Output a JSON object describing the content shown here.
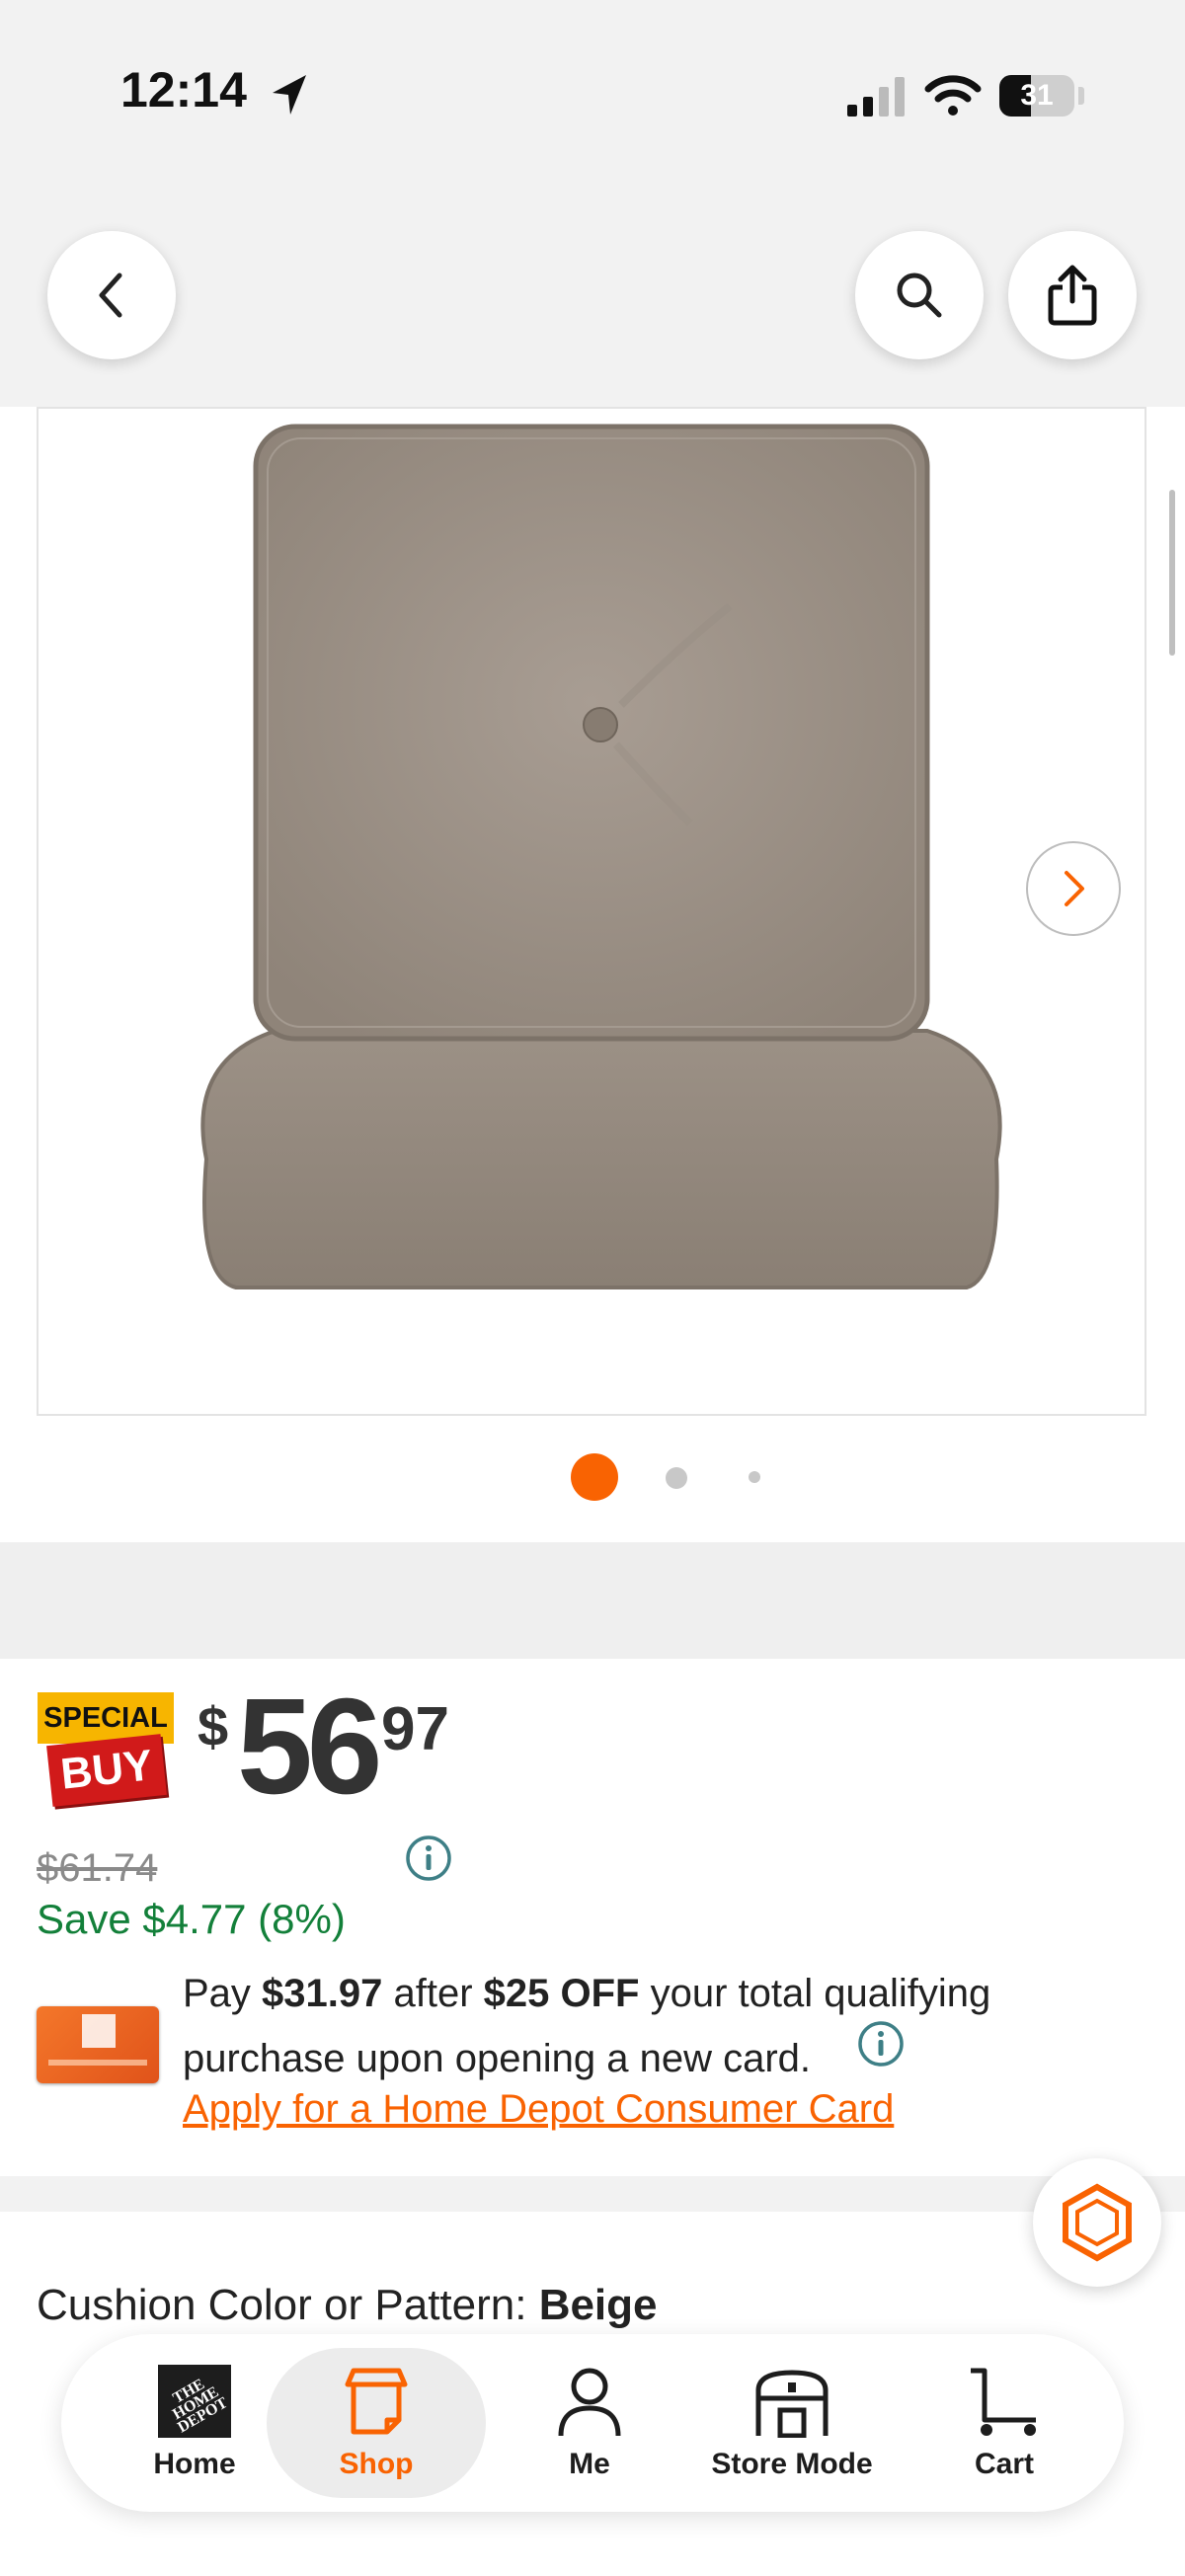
{
  "status_bar": {
    "time": "12:14",
    "battery": "31"
  },
  "gallery": {
    "total_dots": 3,
    "active_dot": 0
  },
  "badge": {
    "top": "SPECIAL",
    "bottom": "BUY"
  },
  "price": {
    "currency": "$",
    "dollars": "56",
    "cents": "97",
    "was": "$61.74",
    "save": "Save $4.77 (8%)"
  },
  "card_offer": {
    "pay": "Pay ",
    "pay_amount": "$31.97",
    "after": " after ",
    "discount": "$25 OFF",
    "rest": " your total qualifying purchase upon opening a new card.",
    "apply_link": "Apply for a Home Depot Consumer Card"
  },
  "cushion": {
    "label": "Cushion Color or Pattern: ",
    "value": "Beige"
  },
  "tabs": [
    {
      "label": "Home",
      "icon": "home-depot-logo-icon"
    },
    {
      "label": "Shop",
      "icon": "shop-icon"
    },
    {
      "label": "Me",
      "icon": "person-icon"
    },
    {
      "label": "Store Mode",
      "icon": "store-icon"
    },
    {
      "label": "Cart",
      "icon": "cart-icon"
    }
  ],
  "colors": {
    "brand_orange": "#f96302",
    "save_green": "#13803a",
    "link_orange": "#f96302",
    "info_teal": "#3e7f86"
  }
}
